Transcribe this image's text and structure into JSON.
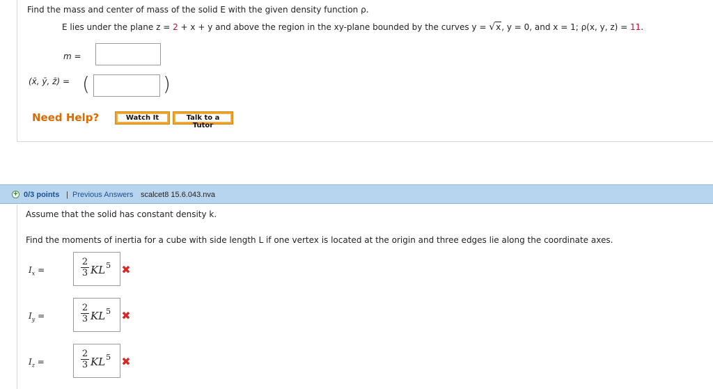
{
  "q1": {
    "prompt": "Find the mass and center of mass of the solid E with the given density function ρ.",
    "desc_part1": "E lies under the plane  z = ",
    "desc_red1": "2",
    "desc_part2": " + x + y  and above the region in the xy-plane bounded by the curves  y = ",
    "desc_sqrt_arg": "x",
    "desc_part3": ", y = 0,  and  x = 1;   ρ(x, y, z) = ",
    "desc_red2": "11",
    "desc_part4": ".",
    "mass_label": "m =",
    "center_label": "(x̄, ȳ, z̄) =",
    "paren_open": "(",
    "paren_close": ")",
    "mass_value": "",
    "center_value": "",
    "need_help": "Need Help?",
    "watch_label": "Watch It",
    "tutor_label": "Talk to a Tutor"
  },
  "q2": {
    "points": "0/3 points",
    "separator": "|",
    "previous_answers": "Previous Answers",
    "code": "scalcet8 15.6.043.nva",
    "line1": "Assume that the solid has constant density k.",
    "line2": "Find the moments of inertia for a cube with side length L if one vertex is located at the origin and three edges lie along the coordinate axes.",
    "answers": [
      {
        "label": "I",
        "sub": "x",
        "eq": " =",
        "num": "2",
        "den": "3",
        "expr": "KL",
        "exp": "5",
        "status": "incorrect"
      },
      {
        "label": "I",
        "sub": "y",
        "eq": " =",
        "num": "2",
        "den": "3",
        "expr": "KL",
        "exp": "5",
        "status": "incorrect"
      },
      {
        "label": "I",
        "sub": "z",
        "eq": " =",
        "num": "2",
        "den": "3",
        "expr": "KL",
        "exp": "5",
        "status": "incorrect"
      }
    ],
    "incorrect_mark": "✖"
  },
  "colors": {
    "accent_red": "#c8102e",
    "help_orange": "#d96b00",
    "button_orange": "#f7a21c",
    "header_blue": "#b8d5ef",
    "link_blue": "#1f4e99",
    "wrong_red": "#d62828"
  }
}
